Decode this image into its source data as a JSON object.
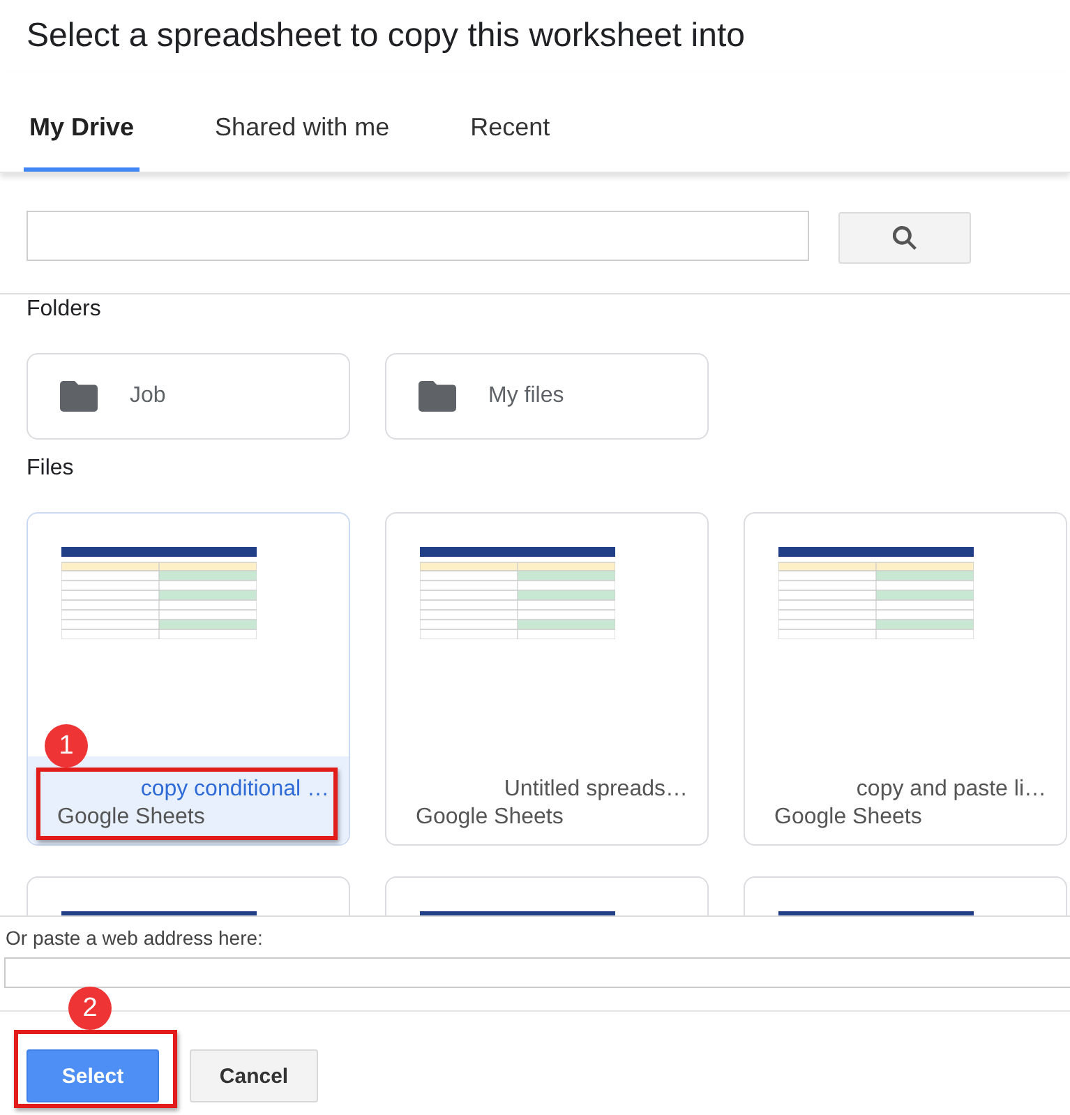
{
  "dialog": {
    "title": "Select a spreadsheet to copy this worksheet into"
  },
  "tabs": [
    {
      "label": "My Drive",
      "selected": true
    },
    {
      "label": "Shared with me",
      "selected": false
    },
    {
      "label": "Recent",
      "selected": false
    }
  ],
  "folders": {
    "heading": "Folders",
    "items": [
      {
        "name": "Job"
      },
      {
        "name": "My files"
      }
    ]
  },
  "files": {
    "heading": "Files",
    "items": [
      {
        "name": "copy conditional …",
        "type": "Google Sheets",
        "selected": true,
        "callout": "1"
      },
      {
        "name": "Untitled spreads…",
        "type": "Google Sheets",
        "selected": false
      },
      {
        "name": "copy and paste li…",
        "type": "Google Sheets",
        "selected": false
      },
      {
        "selected": false
      },
      {
        "selected": false
      },
      {
        "selected": false
      }
    ]
  },
  "url_field": {
    "label": "Or paste a web address here:"
  },
  "buttons": [
    {
      "label": "Select",
      "kind": "primary",
      "callout": "2"
    },
    {
      "label": "Cancel",
      "kind": "secondary"
    }
  ]
}
